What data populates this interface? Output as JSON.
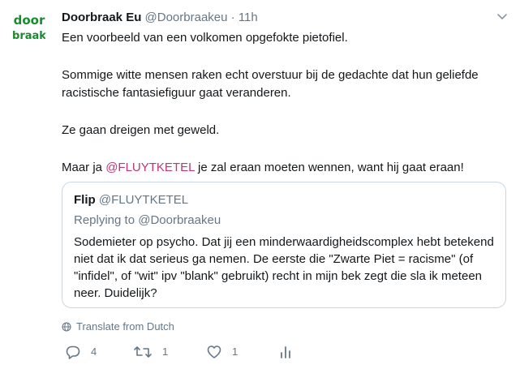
{
  "tweet": {
    "author_name": "Doorbraak Eu",
    "author_handle": "@Doorbraakeu",
    "separator": "·",
    "timestamp": "11h",
    "avatar_text_top": "door",
    "avatar_text_bottom": "braak",
    "avatar_color": "#1a8a2e",
    "paragraphs": [
      "Een voorbeeld van een volkomen opgefokte pietofiel.",
      "Sommige witte mensen raken echt overstuur bij de gedachte dat hun geliefde racistische fantasiefiguur gaat veranderen.",
      "Ze gaan dreigen met geweld."
    ],
    "last_paragraph": {
      "before": "Maar ja ",
      "mention": "@FLUYTKETEL",
      "after": " je zal eraan moeten wennen, want hij gaat eraan!"
    }
  },
  "quote": {
    "author_name": "Flip",
    "author_handle": "@FLUYTKETEL",
    "reply_prefix": "Replying to ",
    "reply_handle": "@Doorbraakeu",
    "text": "Sodemieter op psycho. Dat jij een minderwaardigheidscomplex hebt betekend niet dat ik dat serieus ga nemen. De eerste die \"Zwarte Piet = racisme\" (of \"infidel\", of \"wit\" ipv \"blank\" gebruikt) recht in mijn bek zegt die sla ik meteen neer. Duidelijk?"
  },
  "translate": {
    "icon": "globe-icon",
    "label": "Translate from Dutch"
  },
  "actions": {
    "reply_count": "4",
    "retweet_count": "1",
    "like_count": "1"
  },
  "colors": {
    "text": "#14171a",
    "secondary": "#657786",
    "mention": "#c0347a",
    "border": "#ccd6dd"
  }
}
